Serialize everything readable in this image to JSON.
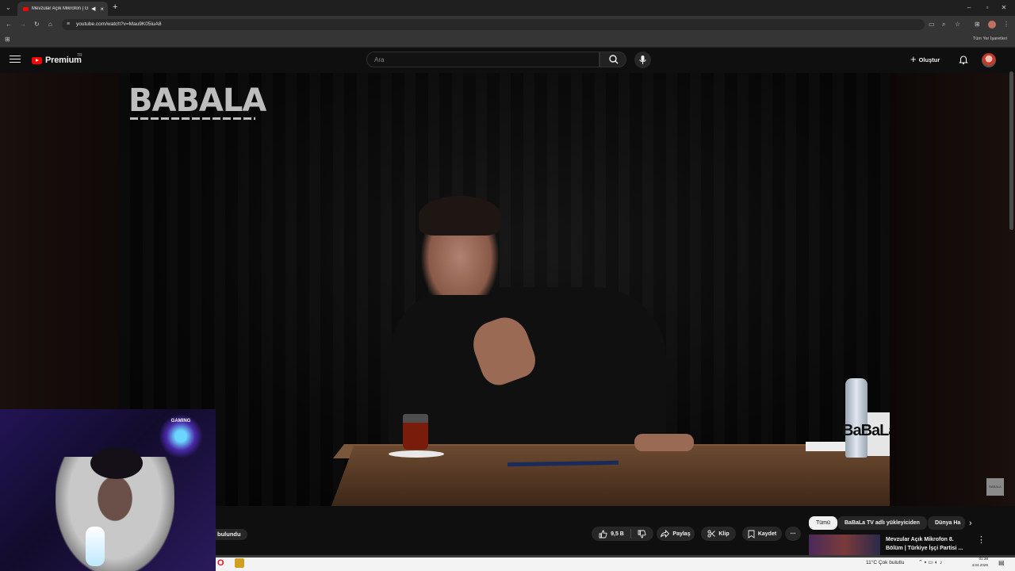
{
  "browser": {
    "tab_title": "Mevzular Açık Mikrofon | G",
    "url": "youtube.com/watch?v=Mau9K05iuA8",
    "bookmarks_label": "Tüm Yer İşaretleri"
  },
  "header": {
    "logo_text": "Premium",
    "region_code": "TR",
    "search_placeholder": "Ara",
    "create_label": "Oluştur"
  },
  "video": {
    "watermark_logo": "BABALA",
    "mug_text": "BaBaLa",
    "channel_watermark": "BABALA"
  },
  "overlay": {
    "badge_text": "GAMING"
  },
  "actions": {
    "found_label": "bulundu",
    "like_count": "9,5 B",
    "share_label": "Paylaş",
    "clip_label": "Klip",
    "save_label": "Kaydet"
  },
  "chips": {
    "all": "Tümü",
    "uploader": "BaBaLa TV adlı yükleyiciden",
    "world": "Dünya Ha"
  },
  "recommendation": {
    "title": "Mevzular Açık Mikrofon 8. Bölüm | Türkiye İşçi Partisi ..."
  },
  "taskbar": {
    "weather": "11°C  Çok bulutlu",
    "time": "01:36",
    "date": "4.04.2026"
  },
  "colors": {
    "brand_red": "#ff0000",
    "background": "#0f0f0f",
    "chip_bg": "#272727"
  }
}
